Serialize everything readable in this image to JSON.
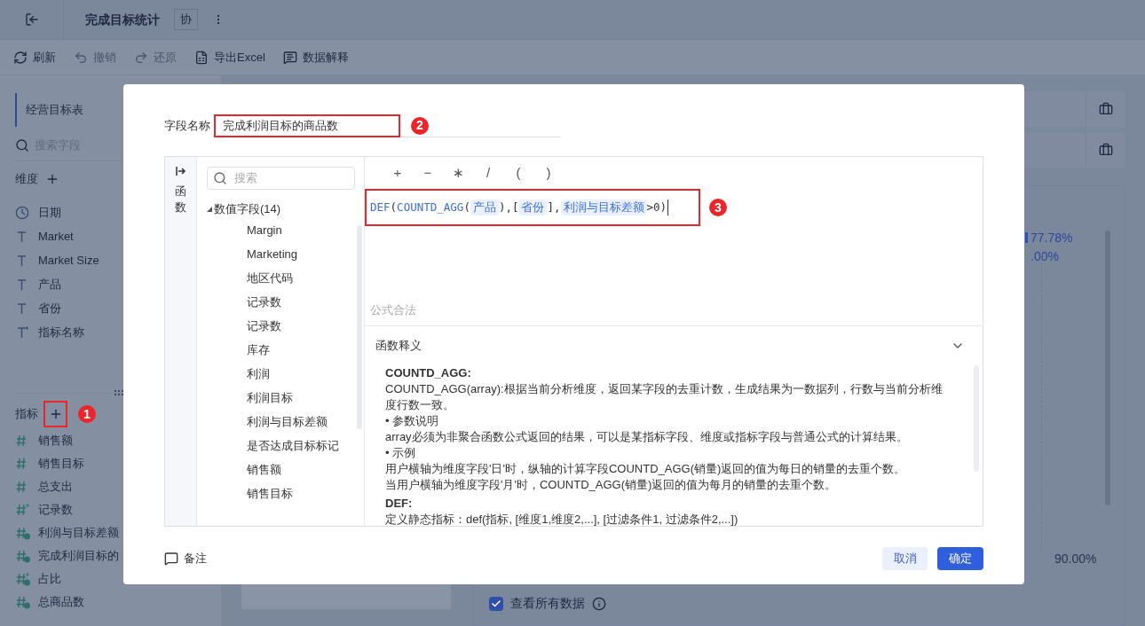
{
  "header": {
    "title": "完成目标统计",
    "badge": "协"
  },
  "toolbar": [
    {
      "label": "刷新",
      "kind": "refresh",
      "disabled": false
    },
    {
      "label": "撤销",
      "kind": "undo",
      "disabled": true
    },
    {
      "label": "还原",
      "kind": "redo",
      "disabled": true
    },
    {
      "label": "导出Excel",
      "kind": "excel",
      "disabled": false
    },
    {
      "label": "数据解释",
      "kind": "explain",
      "disabled": false
    }
  ],
  "sidebar": {
    "table": "经营目标表",
    "search_placeholder": "搜索字段",
    "dimensions": {
      "title": "维度",
      "items": [
        {
          "label": "日期",
          "kind": "date"
        },
        {
          "label": "Market",
          "kind": "text"
        },
        {
          "label": "Market Size",
          "kind": "text"
        },
        {
          "label": "产品",
          "kind": "text"
        },
        {
          "label": "省份",
          "kind": "text"
        },
        {
          "label": "指标名称",
          "kind": "text_calc"
        }
      ]
    },
    "measures": {
      "title": "指标",
      "step": "1",
      "items": [
        {
          "label": "销售额",
          "kind": "number"
        },
        {
          "label": "销售目标",
          "kind": "number"
        },
        {
          "label": "总支出",
          "kind": "number"
        },
        {
          "label": "记录数",
          "kind": "number_calc"
        },
        {
          "label": "利润与目标差额",
          "kind": "formula"
        },
        {
          "label": "完成利润目标的",
          "kind": "formula"
        },
        {
          "label": "占比",
          "kind": "formula_calc"
        },
        {
          "label": "总商品数",
          "kind": "formula"
        }
      ]
    }
  },
  "chart": {
    "labels": [
      "77.78%",
      ".00%"
    ],
    "axis_label": "90.00%"
  },
  "view_all": {
    "label": "查看所有数据",
    "checked": true
  },
  "dialog": {
    "name_label": "字段名称",
    "name_value": "完成利润目标的商品数",
    "name_step": "2",
    "side_tab": "函数",
    "search_placeholder": "搜索",
    "field_group": {
      "label": "数值字段(14)",
      "expanded": true,
      "children": [
        "Margin",
        "Marketing",
        "地区代码",
        "记录数",
        "记录数",
        "库存",
        "利润",
        "利润目标",
        "利润与目标差额",
        "是否达成目标标记",
        "销售额",
        "销售目标"
      ]
    },
    "operators": [
      "+",
      "−",
      "∗",
      "/",
      "(",
      ")"
    ],
    "formula": [
      {
        "text": "DEF",
        "kind": "func"
      },
      {
        "text": "(",
        "kind": "punct"
      },
      {
        "text": "COUNTD_AGG",
        "kind": "func"
      },
      {
        "text": "(",
        "kind": "punct"
      },
      {
        "text": "产品",
        "kind": "field"
      },
      {
        "text": "),[",
        "kind": "punct"
      },
      {
        "text": "省份",
        "kind": "field"
      },
      {
        "text": "],",
        "kind": "punct"
      },
      {
        "text": "利润与目标差额",
        "kind": "field"
      },
      {
        "text": ">0)",
        "kind": "punct"
      }
    ],
    "formula_step": "3",
    "status": "公式合法",
    "help_title": "函数释义",
    "help_expanded": true,
    "help": [
      {
        "title": "COUNTD_AGG:",
        "lines": [
          "COUNTD_AGG(array):根据当前分析维度，返回某字段的去重计数，生成结果为一数据列，行数与当前分析维度行数一致。",
          "• 参数说明",
          "array必须为非聚合函数公式返回的结果，可以是某指标字段、维度或指标字段与普通公式的计算结果。",
          "• 示例",
          "用户横轴为维度字段'日'时，纵轴的计算字段COUNTD_AGG(销量)返回的值为每日的销量的去重个数。",
          "当用户横轴为维度字段'月'时，COUNTD_AGG(销量)返回的值为每月的销量的去重个数。"
        ]
      },
      {
        "title": "DEF:",
        "lines": [
          "定义静态指标：def(指标, [维度1,维度2,...], [过滤条件1, 过滤条件2,...])"
        ]
      }
    ],
    "note": "备注",
    "cancel": "取消",
    "confirm": "确定"
  }
}
